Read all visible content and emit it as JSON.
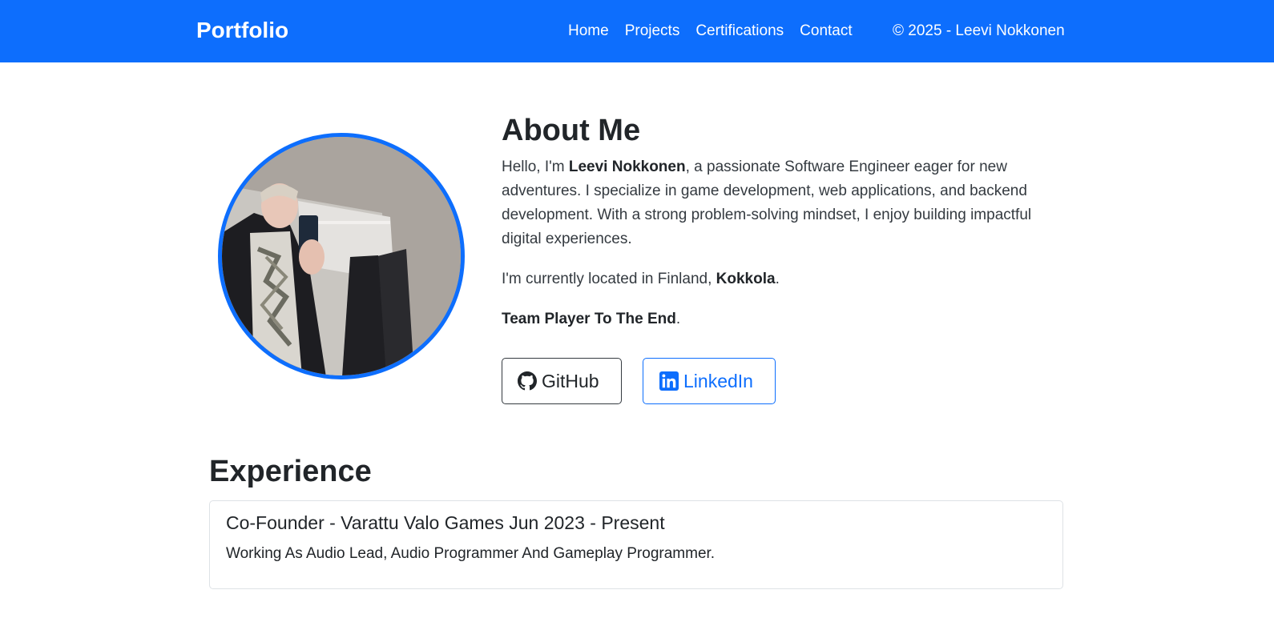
{
  "navbar": {
    "brand": "Portfolio",
    "links": [
      "Home",
      "Projects",
      "Certifications",
      "Contact"
    ],
    "copyright": "© 2025 - Leevi Nokkonen",
    "bg_color": "#0d6efd"
  },
  "about": {
    "heading": "About Me",
    "intro_pre": "Hello, I'm ",
    "name": "Leevi Nokkonen",
    "intro_post": ", a passionate Software Engineer eager for new adventures. I specialize in game development, web applications, and backend development. With a strong problem-solving mindset, I enjoy building impactful digital experiences.",
    "location_pre": "I'm currently located in Finland, ",
    "city": "Kokkola",
    "location_post": ".",
    "motto": "Team Player To The End",
    "motto_post": ".",
    "avatar_icon": "profile-photo"
  },
  "buttons": {
    "github_label": "GitHub",
    "github_icon": "github-icon",
    "linkedin_label": "LinkedIn",
    "linkedin_icon": "linkedin-icon"
  },
  "experience": {
    "heading": "Experience",
    "items": [
      {
        "title": "Co-Founder - Varattu Valo Games Jun 2023 - Present",
        "description": "Working As Audio Lead, Audio Programmer And Gameplay Programmer."
      }
    ]
  },
  "colors": {
    "accent": "#0d6efd",
    "text": "#212529",
    "card_border": "#dee2e6"
  }
}
